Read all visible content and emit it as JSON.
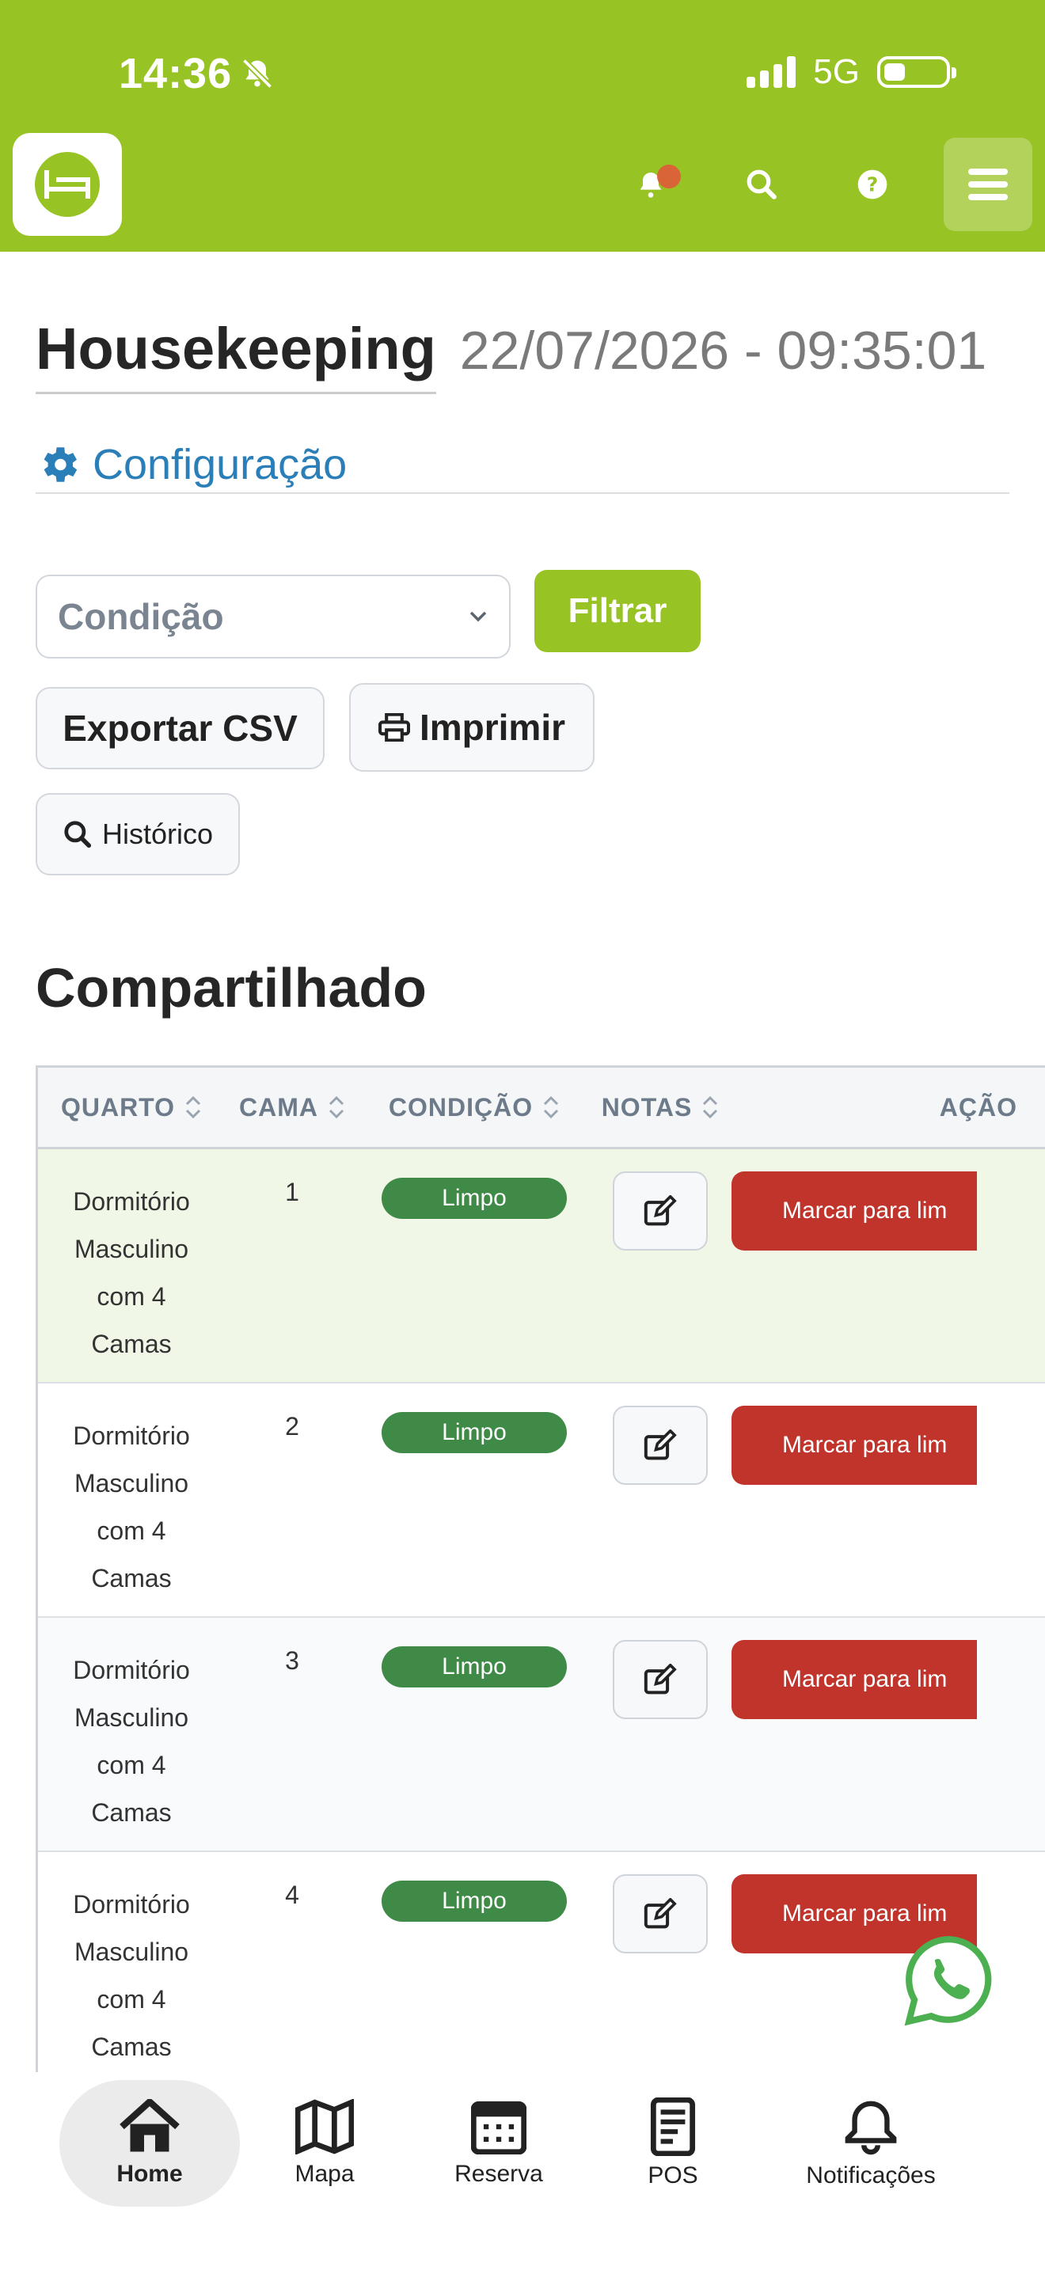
{
  "status_bar": {
    "time": "14:36",
    "network": "5G"
  },
  "header": {
    "logo_icon": "hostel-bed-logo-icon",
    "icons": [
      "bell-icon",
      "search-icon",
      "help-icon",
      "menu-icon"
    ]
  },
  "page": {
    "title": "Housekeeping",
    "datetime": "22/07/2026 - 09:35:01",
    "config_label": "Configuração"
  },
  "filters": {
    "condition_select": "Condição",
    "filter_button": "Filtrar",
    "export_csv": "Exportar CSV",
    "print": "Imprimir",
    "history": "Histórico"
  },
  "section": {
    "title": "Compartilhado"
  },
  "table": {
    "headers": {
      "room": "QUARTO",
      "bed": "CAMA",
      "condition": "CONDIÇÃO",
      "notes": "NOTAS",
      "action": "AÇÃO"
    },
    "rows": [
      {
        "room_line1": "Dormitório",
        "room_line2": "Masculino",
        "room_line3": "com 4",
        "room_line4": "Camas",
        "bed": "1",
        "condition": "Limpo",
        "action": "Marcar para lim"
      },
      {
        "room_line1": "Dormitório",
        "room_line2": "Masculino",
        "room_line3": "com 4",
        "room_line4": "Camas",
        "bed": "2",
        "condition": "Limpo",
        "action": "Marcar para lim"
      },
      {
        "room_line1": "Dormitório",
        "room_line2": "Masculino",
        "room_line3": "com 4",
        "room_line4": "Camas",
        "bed": "3",
        "condition": "Limpo",
        "action": "Marcar para lim"
      },
      {
        "room_line1": "Dormitório",
        "room_line2": "Masculino",
        "room_line3": "com 4",
        "room_line4": "Camas",
        "bed": "4",
        "condition": "Limpo",
        "action": "Marcar para lim"
      }
    ]
  },
  "bottom_nav": {
    "home": "Home",
    "map": "Mapa",
    "reservation": "Reserva",
    "pos": "POS",
    "notifications": "Notificações"
  },
  "colors": {
    "brand_green": "#98c324",
    "clean_badge": "#3f8a46",
    "action_red": "#c0342c",
    "link_blue": "#2a7fb8"
  }
}
